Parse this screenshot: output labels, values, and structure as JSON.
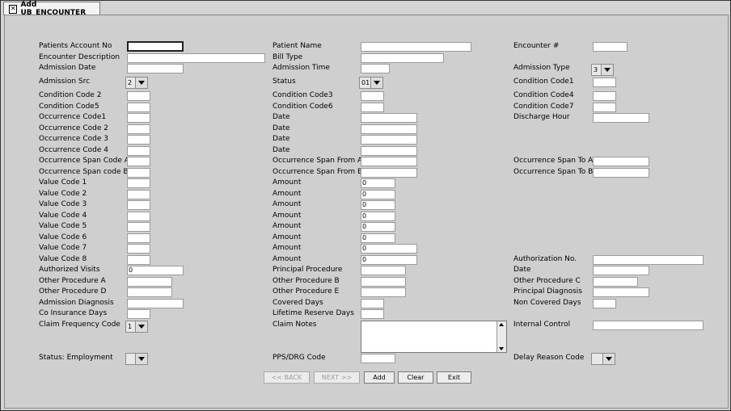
{
  "tab": {
    "title": "Add UB_ENCOUNTER"
  },
  "labels": {
    "patients_account_no": "Patients Account No",
    "patient_name": "Patient Name",
    "encounter_num": "Encounter #",
    "encounter_description": "Encounter Description",
    "bill_type": "Bill Type",
    "admission_date": "Admission Date",
    "admission_time": "Admission Time",
    "admission_type": "Admission Type",
    "admission_src": "Admission Src",
    "status": "Status",
    "condition_code1": "Condition Code1",
    "condition_code2": "Condition Code 2",
    "condition_code3": "Condition Code3",
    "condition_code4": "Condition Code4",
    "condition_code5": "Condition Code5",
    "condition_code6": "Condition Code6",
    "condition_code7": "Condition Code7",
    "occurrence_code1": "Occurrence Code1",
    "occurrence_code2": "Occurrence Code 2",
    "occurrence_code3": "Occurrence Code 3",
    "occurrence_code4": "Occurrence Code 4",
    "date": "Date",
    "discharge_hour": "Discharge Hour",
    "occ_span_code_a": "Occurrence Span Code A",
    "occ_span_from_a": "Occurrence Span From A",
    "occ_span_to_a": "Occurrence Span To A",
    "occ_span_code_b": "Occurrence Span code B",
    "occ_span_from_b": "Occurrence Span From B",
    "occ_span_to_b": "Occurrence Span To B",
    "value_code1": "Value Code 1",
    "value_code2": "Value Code 2",
    "value_code3": "Value Code 3",
    "value_code4": "Value Code 4",
    "value_code5": "Value Code 5",
    "value_code6": "Value Code 6",
    "value_code7": "Value Code 7",
    "value_code8": "Value Code 8",
    "amount": "Amount",
    "authorization_no": "Authorization No.",
    "authorized_visits": "Authorized Visits",
    "principal_procedure": "Principal Procedure",
    "other_procedure_a": "Other Procedure A",
    "other_procedure_b": "Other Procedure B",
    "other_procedure_c": "Other Procedure C",
    "other_procedure_d": "Other Procedure D",
    "other_procedure_e": "Other Procedure E",
    "principal_diagnosis": "Principal Diagnosis",
    "admission_diagnosis": "Admission Diagnosis",
    "covered_days": "Covered Days",
    "non_covered_days": "Non Covered Days",
    "co_insurance_days": "Co Insurance Days",
    "lifetime_reserve_days": "Lifetime Reserve Days",
    "claim_frequency_code": "Claim Frequency Code",
    "claim_notes": "Claim Notes",
    "internal_control": "Internal Control",
    "status_employment": "Status: Employment",
    "pps_drg_code": "PPS/DRG Code",
    "delay_reason_code": "Delay Reason Code"
  },
  "values": {
    "admission_type": "3",
    "admission_src": "2",
    "status": "01",
    "claim_frequency_code": "1",
    "amount": "0",
    "authorized_visits": "0"
  },
  "buttons": {
    "back": "<< BACK",
    "next": "NEXT >>",
    "add": "Add",
    "clear": "Clear",
    "exit": "Exit"
  }
}
